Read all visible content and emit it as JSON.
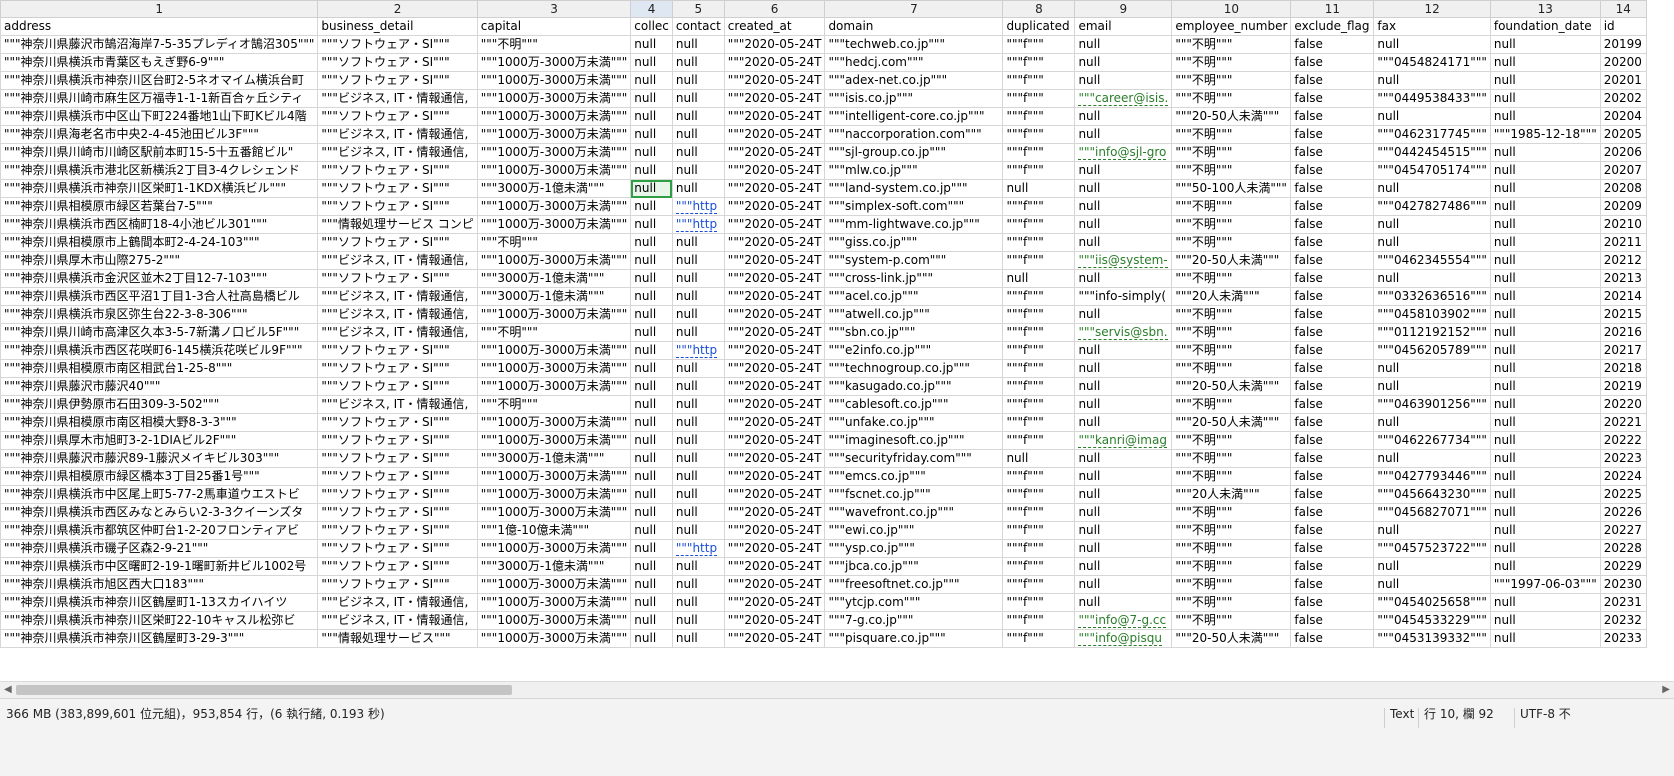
{
  "column_numbers": [
    "1",
    "2",
    "3",
    "4",
    "5",
    "6",
    "7",
    "8",
    "9",
    "10",
    "11",
    "12",
    "13",
    "14"
  ],
  "selected_column_index": 3,
  "fields": [
    "address",
    "business_detail",
    "capital",
    "collec",
    "contact",
    "created_at",
    "domain",
    "duplicated",
    "email",
    "employee_number",
    "exclude_flag",
    "fax",
    "foundation_date",
    "id"
  ],
  "rows": [
    [
      "\"\"\"神奈川県藤沢市鵠沼海岸7-5-35プレディオ鵠沼305\"\"\"",
      "\"\"\"ソフトウェア・SI\"\"\"",
      "\"\"\"不明\"\"\"",
      "null",
      "null",
      "\"\"\"2020-05-24T",
      "\"\"\"techweb.co.jp\"\"\"",
      "\"\"\"f\"\"\"",
      "null",
      "\"\"\"不明\"\"\"",
      "false",
      "null",
      "null",
      "20199"
    ],
    [
      "\"\"\"神奈川県横浜市青葉区もえぎ野6-9\"\"\"",
      "\"\"\"ソフトウェア・SI\"\"\"",
      "\"\"\"1000万-3000万未満\"\"\"",
      "null",
      "null",
      "\"\"\"2020-05-24T",
      "\"\"\"hedcj.com\"\"\"",
      "\"\"\"f\"\"\"",
      "null",
      "\"\"\"不明\"\"\"",
      "false",
      "\"\"\"0454824171\"\"\"",
      "null",
      "20200"
    ],
    [
      "\"\"\"神奈川県横浜市神奈川区台町2-5ネオマイム横浜台町",
      "\"\"\"ソフトウェア・SI\"\"\"",
      "\"\"\"1000万-3000万未満\"\"\"",
      "null",
      "null",
      "\"\"\"2020-05-24T",
      "\"\"\"adex-net.co.jp\"\"\"",
      "\"\"\"f\"\"\"",
      "null",
      "\"\"\"不明\"\"\"",
      "false",
      "null",
      "null",
      "20201"
    ],
    [
      "\"\"\"神奈川県川崎市麻生区万福寺1-1-1新百合ヶ丘シティ",
      "\"\"\"ビジネス, IT・情報通信,",
      "\"\"\"1000万-3000万未満\"\"\"",
      "null",
      "null",
      "\"\"\"2020-05-24T",
      "\"\"\"isis.co.jp\"\"\"",
      "\"\"\"f\"\"\"",
      "\"\"\"career@isis.",
      "\"\"\"不明\"\"\"",
      "false",
      "\"\"\"0449538433\"\"\"",
      "null",
      "20202"
    ],
    [
      "\"\"\"神奈川県横浜市中区山下町224番地1山下町Kビル4階",
      "\"\"\"ソフトウェア・SI\"\"\"",
      "\"\"\"1000万-3000万未満\"\"\"",
      "null",
      "null",
      "\"\"\"2020-05-24T",
      "\"\"\"intelligent-core.co.jp\"\"\"",
      "\"\"\"f\"\"\"",
      "null",
      "\"\"\"20-50人未満\"\"\"",
      "false",
      "null",
      "null",
      "20204"
    ],
    [
      "\"\"\"神奈川県海老名市中央2-4-45池田ビル3F\"\"\"",
      "\"\"\"ビジネス, IT・情報通信,",
      "\"\"\"1000万-3000万未満\"\"\"",
      "null",
      "null",
      "\"\"\"2020-05-24T",
      "\"\"\"naccorporation.com\"\"\"",
      "\"\"\"f\"\"\"",
      "null",
      "\"\"\"不明\"\"\"",
      "false",
      "\"\"\"0462317745\"\"\"",
      "\"\"\"1985-12-18\"\"\"",
      "20205"
    ],
    [
      "\"\"\"神奈川県川崎市川崎区駅前本町15-5十五番館ビル\"",
      "\"\"\"ビジネス, IT・情報通信,",
      "\"\"\"1000万-3000万未満\"\"\"",
      "null",
      "null",
      "\"\"\"2020-05-24T",
      "\"\"\"sjl-group.co.jp\"\"\"",
      "\"\"\"f\"\"\"",
      "\"\"\"info@sjl-gro",
      "\"\"\"不明\"\"\"",
      "false",
      "\"\"\"0442454515\"\"\"",
      "null",
      "20206"
    ],
    [
      "\"\"\"神奈川県横浜市港北区新横浜2丁目3-4クレシェンド",
      "\"\"\"ソフトウェア・SI\"\"\"",
      "\"\"\"1000万-3000万未満\"\"\"",
      "null",
      "null",
      "\"\"\"2020-05-24T",
      "\"\"\"mlw.co.jp\"\"\"",
      "\"\"\"f\"\"\"",
      "null",
      "\"\"\"不明\"\"\"",
      "false",
      "\"\"\"0454705174\"\"\"",
      "null",
      "20207"
    ],
    [
      "\"\"\"神奈川県横浜市神奈川区栄町1-1KDX横浜ビル\"\"\"",
      "\"\"\"ソフトウェア・SI\"\"\"",
      "\"\"\"3000万-1億未満\"\"\"",
      "null",
      "null",
      "\"\"\"2020-05-24T",
      "\"\"\"land-system.co.jp\"\"\"",
      "null",
      "null",
      "\"\"\"50-100人未満\"\"\"",
      "false",
      "null",
      "null",
      "20208"
    ],
    [
      "\"\"\"神奈川県相模原市緑区若葉台7-5\"\"\"",
      "\"\"\"ソフトウェア・SI\"\"\"",
      "\"\"\"1000万-3000万未満\"\"\"",
      "null",
      "\"\"\"http",
      "\"\"\"2020-05-24T",
      "\"\"\"simplex-soft.com\"\"\"",
      "\"\"\"f\"\"\"",
      "null",
      "\"\"\"不明\"\"\"",
      "false",
      "\"\"\"0427827486\"\"\"",
      "null",
      "20209"
    ],
    [
      "\"\"\"神奈川県横浜市西区楠町18-4小池ビル301\"\"\"",
      "\"\"\"情報処理サービス コンピ",
      "\"\"\"1000万-3000万未満\"\"\"",
      "null",
      "\"\"\"http",
      "\"\"\"2020-05-24T",
      "\"\"\"mm-lightwave.co.jp\"\"\"",
      "\"\"\"f\"\"\"",
      "null",
      "\"\"\"不明\"\"\"",
      "false",
      "null",
      "null",
      "20210"
    ],
    [
      "\"\"\"神奈川県相模原市上鶴間本町2-4-24-103\"\"\"",
      "\"\"\"ソフトウェア・SI\"\"\"",
      "\"\"\"不明\"\"\"",
      "null",
      "null",
      "\"\"\"2020-05-24T",
      "\"\"\"giss.co.jp\"\"\"",
      "\"\"\"f\"\"\"",
      "null",
      "\"\"\"不明\"\"\"",
      "false",
      "null",
      "null",
      "20211"
    ],
    [
      "\"\"\"神奈川県厚木市山際275-2\"\"\"",
      "\"\"\"ビジネス, IT・情報通信,",
      "\"\"\"1000万-3000万未満\"\"\"",
      "null",
      "null",
      "\"\"\"2020-05-24T",
      "\"\"\"system-p.com\"\"\"",
      "\"\"\"f\"\"\"",
      "\"\"\"iis@system-",
      "\"\"\"20-50人未満\"\"\"",
      "false",
      "\"\"\"0462345554\"\"\"",
      "null",
      "20212"
    ],
    [
      "\"\"\"神奈川県横浜市金沢区並木2丁目12-7-103\"\"\"",
      "\"\"\"ソフトウェア・SI\"\"\"",
      "\"\"\"3000万-1億未満\"\"\"",
      "null",
      "null",
      "\"\"\"2020-05-24T",
      "\"\"\"cross-link.jp\"\"\"",
      "null",
      "null",
      "\"\"\"不明\"\"\"",
      "false",
      "null",
      "null",
      "20213"
    ],
    [
      "\"\"\"神奈川県横浜市西区平沼1丁目1-3合人社高島橋ビル",
      "\"\"\"ビジネス, IT・情報通信,",
      "\"\"\"3000万-1億未満\"\"\"",
      "null",
      "null",
      "\"\"\"2020-05-24T",
      "\"\"\"acel.co.jp\"\"\"",
      "\"\"\"f\"\"\"",
      "\"\"\"info-simply(",
      "\"\"\"20人未満\"\"\"",
      "false",
      "\"\"\"0332636516\"\"\"",
      "null",
      "20214"
    ],
    [
      "\"\"\"神奈川県横浜市泉区弥生台22-3-8-306\"\"\"",
      "\"\"\"ビジネス, IT・情報通信,",
      "\"\"\"1000万-3000万未満\"\"\"",
      "null",
      "null",
      "\"\"\"2020-05-24T",
      "\"\"\"atwell.co.jp\"\"\"",
      "\"\"\"f\"\"\"",
      "null",
      "\"\"\"不明\"\"\"",
      "false",
      "\"\"\"0458103902\"\"\"",
      "null",
      "20215"
    ],
    [
      "\"\"\"神奈川県川崎市高津区久本3-5-7新溝ノ口ビル5F\"\"\"",
      "\"\"\"ビジネス, IT・情報通信,",
      "\"\"\"不明\"\"\"",
      "null",
      "null",
      "\"\"\"2020-05-24T",
      "\"\"\"sbn.co.jp\"\"\"",
      "\"\"\"f\"\"\"",
      "\"\"\"servis@sbn.",
      "\"\"\"不明\"\"\"",
      "false",
      "\"\"\"0112192152\"\"\"",
      "null",
      "20216"
    ],
    [
      "\"\"\"神奈川県横浜市西区花咲町6-145横浜花咲ビル9F\"\"\"",
      "\"\"\"ソフトウェア・SI\"\"\"",
      "\"\"\"1000万-3000万未満\"\"\"",
      "null",
      "\"\"\"http",
      "\"\"\"2020-05-24T",
      "\"\"\"e2info.co.jp\"\"\"",
      "\"\"\"f\"\"\"",
      "null",
      "\"\"\"不明\"\"\"",
      "false",
      "\"\"\"0456205789\"\"\"",
      "null",
      "20217"
    ],
    [
      "\"\"\"神奈川県相模原市南区相武台1-25-8\"\"\"",
      "\"\"\"ソフトウェア・SI\"\"\"",
      "\"\"\"1000万-3000万未満\"\"\"",
      "null",
      "null",
      "\"\"\"2020-05-24T",
      "\"\"\"technogroup.co.jp\"\"\"",
      "\"\"\"f\"\"\"",
      "null",
      "\"\"\"不明\"\"\"",
      "false",
      "null",
      "null",
      "20218"
    ],
    [
      "\"\"\"神奈川県藤沢市藤沢40\"\"\"",
      "\"\"\"ソフトウェア・SI\"\"\"",
      "\"\"\"1000万-3000万未満\"\"\"",
      "null",
      "null",
      "\"\"\"2020-05-24T",
      "\"\"\"kasugado.co.jp\"\"\"",
      "\"\"\"f\"\"\"",
      "null",
      "\"\"\"20-50人未満\"\"\"",
      "false",
      "null",
      "null",
      "20219"
    ],
    [
      "\"\"\"神奈川県伊勢原市石田309-3-502\"\"\"",
      "\"\"\"ビジネス, IT・情報通信,",
      "\"\"\"不明\"\"\"",
      "null",
      "null",
      "\"\"\"2020-05-24T",
      "\"\"\"cablesoft.co.jp\"\"\"",
      "\"\"\"f\"\"\"",
      "null",
      "\"\"\"不明\"\"\"",
      "false",
      "\"\"\"0463901256\"\"\"",
      "null",
      "20220"
    ],
    [
      "\"\"\"神奈川県相模原市南区相模大野8-3-3\"\"\"",
      "\"\"\"ソフトウェア・SI\"\"\"",
      "\"\"\"1000万-3000万未満\"\"\"",
      "null",
      "null",
      "\"\"\"2020-05-24T",
      "\"\"\"unfake.co.jp\"\"\"",
      "\"\"\"f\"\"\"",
      "null",
      "\"\"\"20-50人未満\"\"\"",
      "false",
      "null",
      "null",
      "20221"
    ],
    [
      "\"\"\"神奈川県厚木市旭町3-2-1DIAビル2F\"\"\"",
      "\"\"\"ソフトウェア・SI\"\"\"",
      "\"\"\"1000万-3000万未満\"\"\"",
      "null",
      "null",
      "\"\"\"2020-05-24T",
      "\"\"\"imaginesoft.co.jp\"\"\"",
      "\"\"\"f\"\"\"",
      "\"\"\"kanri@imag",
      "\"\"\"不明\"\"\"",
      "false",
      "\"\"\"0462267734\"\"\"",
      "null",
      "20222"
    ],
    [
      "\"\"\"神奈川県藤沢市藤沢89-1藤沢メイキビル303\"\"\"",
      "\"\"\"ソフトウェア・SI\"\"\"",
      "\"\"\"3000万-1億未満\"\"\"",
      "null",
      "null",
      "\"\"\"2020-05-24T",
      "\"\"\"securityfriday.com\"\"\"",
      "null",
      "null",
      "\"\"\"不明\"\"\"",
      "false",
      "null",
      "null",
      "20223"
    ],
    [
      "\"\"\"神奈川県相模原市緑区橋本3丁目25番1号\"\"\"",
      "\"\"\"ソフトウェア・SI\"\"\"",
      "\"\"\"1000万-3000万未満\"\"\"",
      "null",
      "null",
      "\"\"\"2020-05-24T",
      "\"\"\"emcs.co.jp\"\"\"",
      "\"\"\"f\"\"\"",
      "null",
      "\"\"\"不明\"\"\"",
      "false",
      "\"\"\"0427793446\"\"\"",
      "null",
      "20224"
    ],
    [
      "\"\"\"神奈川県横浜市中区尾上町5-77-2馬車道ウエストビ",
      "\"\"\"ソフトウェア・SI\"\"\"",
      "\"\"\"1000万-3000万未満\"\"\"",
      "null",
      "null",
      "\"\"\"2020-05-24T",
      "\"\"\"fscnet.co.jp\"\"\"",
      "\"\"\"f\"\"\"",
      "null",
      "\"\"\"20人未満\"\"\"",
      "false",
      "\"\"\"0456643230\"\"\"",
      "null",
      "20225"
    ],
    [
      "\"\"\"神奈川県横浜市西区みなとみらい2-3-3クイーンズタ",
      "\"\"\"ソフトウェア・SI\"\"\"",
      "\"\"\"1000万-3000万未満\"\"\"",
      "null",
      "null",
      "\"\"\"2020-05-24T",
      "\"\"\"wavefront.co.jp\"\"\"",
      "\"\"\"f\"\"\"",
      "null",
      "\"\"\"不明\"\"\"",
      "false",
      "\"\"\"0456827071\"\"\"",
      "null",
      "20226"
    ],
    [
      "\"\"\"神奈川県横浜市都筑区仲町台1-2-20フロンティアビ",
      "\"\"\"ソフトウェア・SI\"\"\"",
      "\"\"\"1億-10億未満\"\"\"",
      "null",
      "null",
      "\"\"\"2020-05-24T",
      "\"\"\"ewi.co.jp\"\"\"",
      "\"\"\"f\"\"\"",
      "null",
      "\"\"\"不明\"\"\"",
      "false",
      "null",
      "null",
      "20227"
    ],
    [
      "\"\"\"神奈川県横浜市磯子区森2-9-21\"\"\"",
      "\"\"\"ソフトウェア・SI\"\"\"",
      "\"\"\"1000万-3000万未満\"\"\"",
      "null",
      "\"\"\"http",
      "\"\"\"2020-05-24T",
      "\"\"\"ysp.co.jp\"\"\"",
      "\"\"\"f\"\"\"",
      "null",
      "\"\"\"不明\"\"\"",
      "false",
      "\"\"\"0457523722\"\"\"",
      "null",
      "20228"
    ],
    [
      "\"\"\"神奈川県横浜市中区曙町2-19-1曙町新井ビル1002号",
      "\"\"\"ソフトウェア・SI\"\"\"",
      "\"\"\"3000万-1億未満\"\"\"",
      "null",
      "null",
      "\"\"\"2020-05-24T",
      "\"\"\"jbca.co.jp\"\"\"",
      "\"\"\"f\"\"\"",
      "null",
      "\"\"\"不明\"\"\"",
      "false",
      "null",
      "null",
      "20229"
    ],
    [
      "\"\"\"神奈川県横浜市旭区西大口183\"\"\"",
      "\"\"\"ソフトウェア・SI\"\"\"",
      "\"\"\"1000万-3000万未満\"\"\"",
      "null",
      "null",
      "\"\"\"2020-05-24T",
      "\"\"\"freesoftnet.co.jp\"\"\"",
      "\"\"\"f\"\"\"",
      "null",
      "\"\"\"不明\"\"\"",
      "false",
      "null",
      "\"\"\"1997-06-03\"\"\"",
      "20230"
    ],
    [
      "\"\"\"神奈川県横浜市神奈川区鶴屋町1-13スカイハイツ",
      "\"\"\"ビジネス, IT・情報通信,",
      "\"\"\"1000万-3000万未満\"\"\"",
      "null",
      "null",
      "\"\"\"2020-05-24T",
      "\"\"\"ytcjp.com\"\"\"",
      "\"\"\"f\"\"\"",
      "null",
      "\"\"\"不明\"\"\"",
      "false",
      "\"\"\"0454025658\"\"\"",
      "null",
      "20231"
    ],
    [
      "\"\"\"神奈川県横浜市神奈川区栄町22-10キャスル松弥ビ",
      "\"\"\"ビジネス, IT・情報通信,",
      "\"\"\"1000万-3000万未満\"\"\"",
      "null",
      "null",
      "\"\"\"2020-05-24T",
      "\"\"\"7-g.co.jp\"\"\"",
      "\"\"\"f\"\"\"",
      "\"\"\"info@7-g.cc",
      "\"\"\"不明\"\"\"",
      "false",
      "\"\"\"0454533229\"\"\"",
      "null",
      "20232"
    ],
    [
      "\"\"\"神奈川県横浜市神奈川区鶴屋町3-29-3\"\"\"",
      "\"\"\"情報処理サービス\"\"\"",
      "\"\"\"1000万-3000万未満\"\"\"",
      "null",
      "null",
      "\"\"\"2020-05-24T",
      "\"\"\"pisquare.co.jp\"\"\"",
      "\"\"\"f\"\"\"",
      "\"\"\"info@pisqu",
      "\"\"\"20-50人未満\"\"\"",
      "false",
      "\"\"\"0453139332\"\"\"",
      "null",
      "20233"
    ]
  ],
  "status": {
    "file_info": "366 MB (383,899,601 位元組)，953,854 行，(6 執行緒, 0.193 秒)",
    "mode": "Text",
    "position": "行 10, 欄 92",
    "encoding": "UTF-8 不"
  }
}
